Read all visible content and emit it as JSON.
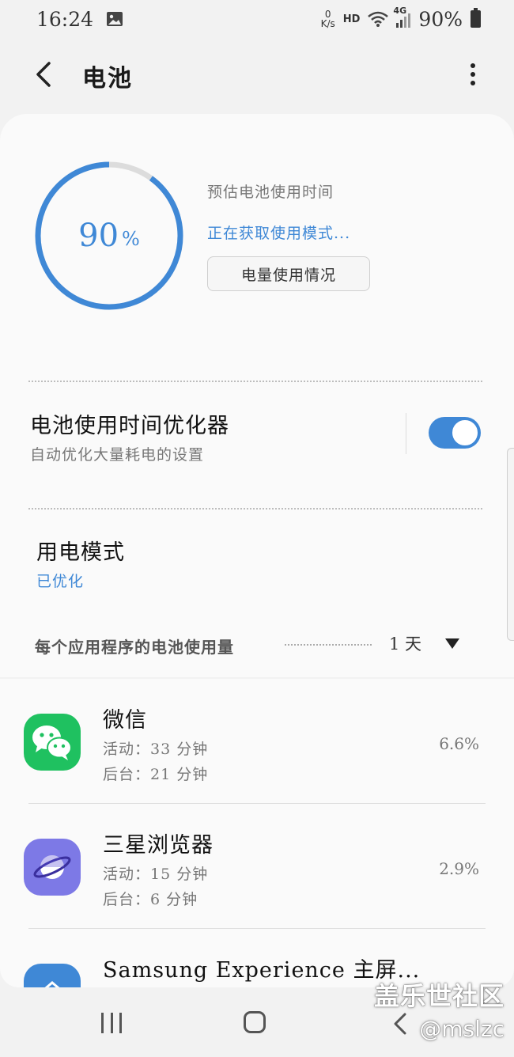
{
  "status_bar": {
    "time": "16:24",
    "net_speed_value": "0",
    "net_speed_unit": "K/s",
    "hd": "HD",
    "network": "4G",
    "battery": "90%"
  },
  "header": {
    "title": "电池"
  },
  "battery": {
    "level": 90,
    "level_text": "90",
    "percent_sign": "%",
    "estimate_label": "预估电池使用时间",
    "estimate_status": "正在获取使用模式...",
    "usage_button": "电量使用情况"
  },
  "optimizer": {
    "title": "电池使用时间优化器",
    "subtitle": "自动优化大量耗电的设置",
    "enabled": true
  },
  "power_mode": {
    "title": "用电模式",
    "value": "已优化"
  },
  "per_app": {
    "label": "每个应用程序的电池使用量",
    "period": "1 天"
  },
  "apps": [
    {
      "name": "微信",
      "active": "活动：33 分钟",
      "background": "后台：21 分钟",
      "percent": "6.6%",
      "icon": "wechat-icon",
      "color": "#1fc160"
    },
    {
      "name": "三星浏览器",
      "active": "活动：15 分钟",
      "background": "后台：6 分钟",
      "percent": "2.9%",
      "icon": "samsung-internet-icon",
      "color": "#7d79e6"
    },
    {
      "name": "Samsung Experience 主屏...",
      "icon": "home-icon",
      "color": "#3f88d6"
    }
  ],
  "watermark": {
    "line1": "盖乐世社区",
    "line2": "@mslzc"
  },
  "colors": {
    "accent": "#3f88d6",
    "ring_track": "#dcdcdc"
  }
}
